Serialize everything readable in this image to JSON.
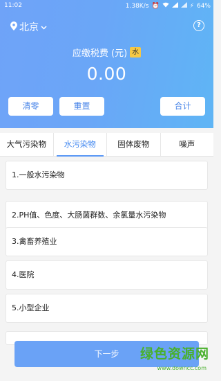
{
  "status": {
    "time": "11:02",
    "speed": "1.38K/s",
    "battery": "64%"
  },
  "header": {
    "city": "北京",
    "tax_label": "应缴税费 (元)",
    "tax_badge": "水",
    "amount": "0.00",
    "buttons": {
      "clear": "清零",
      "reset": "重置",
      "total": "合计"
    }
  },
  "tabs": [
    {
      "label": "大气污染物",
      "active": false
    },
    {
      "label": "水污染物",
      "active": true
    },
    {
      "label": "固体废物",
      "active": false
    },
    {
      "label": "噪声",
      "active": false
    }
  ],
  "items": [
    {
      "label": "1.一般水污染物"
    },
    {
      "label": "2.PH值、色度、大肠菌群数、余氯量水污染物"
    },
    {
      "label": "3.禽畜养殖业"
    },
    {
      "label": "4.医院"
    },
    {
      "label": "5.小型企业"
    }
  ],
  "footer": {
    "next": "下一步"
  },
  "watermark": {
    "text": "绿色资源网",
    "url": "www.downcc.com"
  },
  "colors": {
    "header_gradient_start": "#6fa3f8",
    "header_gradient_end": "#5fb5f5",
    "accent": "#3f86f0",
    "badge": "#f6c844",
    "next_button": "#6aa2f6"
  }
}
